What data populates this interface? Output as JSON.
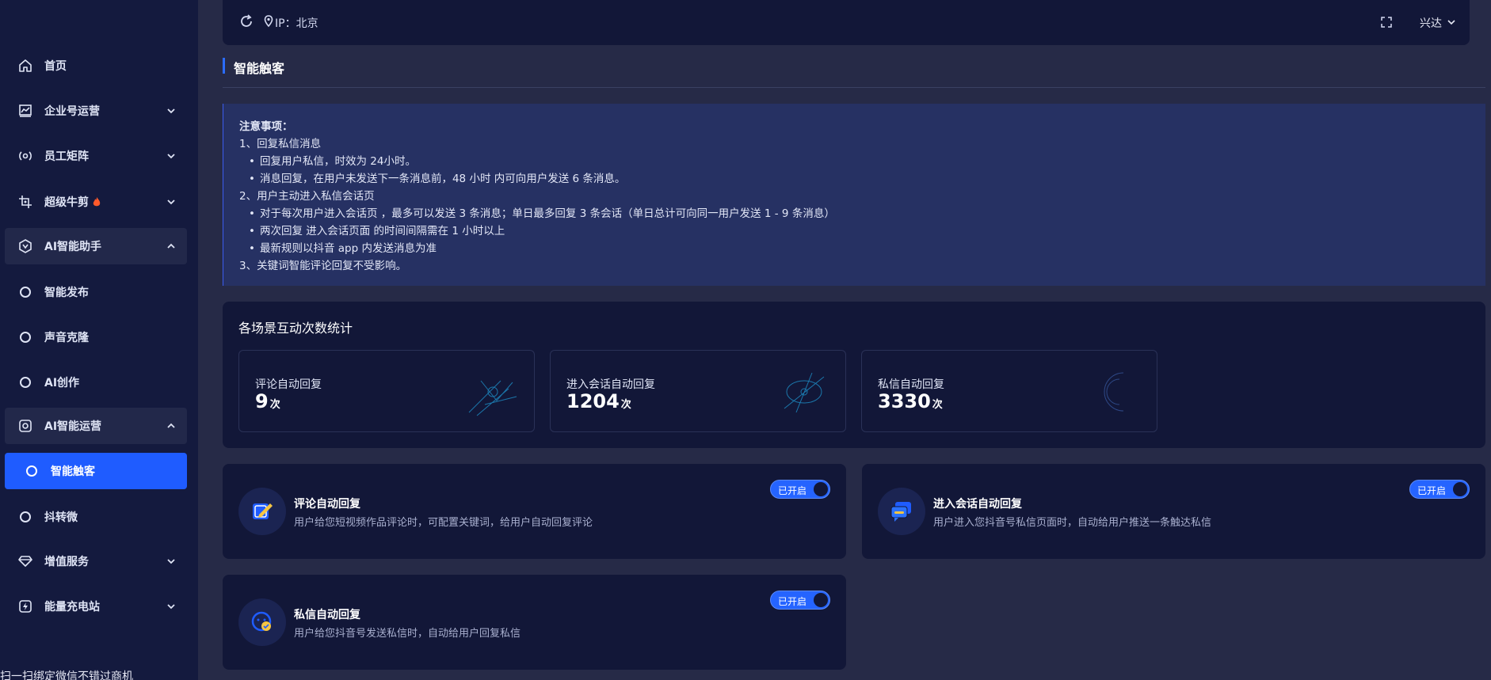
{
  "sidebar": {
    "items": [
      {
        "label": "首页",
        "icon": "home-icon"
      },
      {
        "label": "企业号运营",
        "icon": "chart-icon"
      },
      {
        "label": "员工矩阵",
        "icon": "broadcast-icon"
      },
      {
        "label": "超级牛剪",
        "icon": "crop-icon"
      },
      {
        "label": "AI智能助手",
        "icon": "ai-assistant-icon"
      },
      {
        "label": "智能发布",
        "icon": "circle-icon"
      },
      {
        "label": "声音克隆",
        "icon": "circle-icon"
      },
      {
        "label": "AI创作",
        "icon": "circle-icon"
      },
      {
        "label": "AI智能运营",
        "icon": "ai-operation-icon"
      },
      {
        "label": "智能触客",
        "icon": "circle-icon"
      },
      {
        "label": "抖转微",
        "icon": "circle-icon"
      },
      {
        "label": "增值服务",
        "icon": "diamond-icon"
      },
      {
        "label": "能量充电站",
        "icon": "lightning-icon"
      }
    ],
    "footer": "扫一扫绑定微信不错过商机"
  },
  "topbar": {
    "ip_text": "IP：北京",
    "user_name": "兴达"
  },
  "page": {
    "title": "智能触客"
  },
  "notice": {
    "heading": "注意事项：",
    "lines": [
      "1、回复私信消息",
      "回复用户私信，时效为 24小时。",
      "消息回复，在用户未发送下一条消息前，48 小时 内可向用户发送 6 条消息。",
      "2、用户主动进入私信会话页",
      "对于每次用户进入会话页 ，最多可以发送 3 条消息；单日最多回复 3 条会话（单日总计可向同一用户发送 1 - 9 条消息）",
      "两次回复 进入会话页面 的时间间隔需在 1 小时以上",
      "最新规则以抖音 app 内发送消息为准",
      "3、关键词智能评论回复不受影响。"
    ]
  },
  "stats": {
    "title": "各场景互动次数统计",
    "unit": "次",
    "cards": [
      {
        "label": "评论自动回复",
        "value": "9"
      },
      {
        "label": "进入会话自动回复",
        "value": "1204"
      },
      {
        "label": "私信自动回复",
        "value": "3330"
      }
    ]
  },
  "features": [
    {
      "title": "评论自动回复",
      "desc": "用户给您短视频作品评论时，可配置关键词，给用户自动回复评论",
      "toggle": "已开启",
      "icon": "edit-icon"
    },
    {
      "title": "进入会话自动回复",
      "desc": "用户进入您抖音号私信页面时，自动给用户推送一条触达私信",
      "toggle": "已开启",
      "icon": "chat-icon"
    },
    {
      "title": "私信自动回复",
      "desc": "用户给您抖音号发送私信时，自动给用户回复私信",
      "toggle": "已开启",
      "icon": "message-reply-icon"
    }
  ],
  "colors": {
    "accent": "#1f5cff",
    "sidebar_bg": "#141a3e",
    "panel_bg": "#121738",
    "notice_bg": "#263163"
  }
}
